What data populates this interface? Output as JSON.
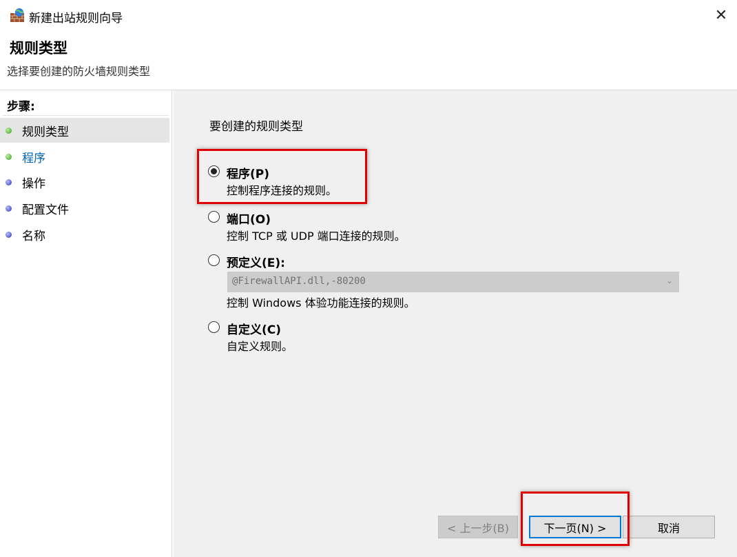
{
  "window": {
    "title": "新建出站规则向导",
    "close_glyph": "✕",
    "icon": "firewall-icon"
  },
  "header": {
    "title": "规则类型",
    "subtitle": "选择要创建的防火墙规则类型"
  },
  "steps": {
    "label": "步骤:",
    "items": [
      {
        "label": "规则类型",
        "status": "current",
        "dot_color": "#2e9e1e"
      },
      {
        "label": "程序",
        "status": "next",
        "dot_color": "#2e9e1e"
      },
      {
        "label": "操作",
        "status": "pending",
        "dot_color": "#2633b8"
      },
      {
        "label": "配置文件",
        "status": "pending",
        "dot_color": "#2633b8"
      },
      {
        "label": "名称",
        "status": "pending",
        "dot_color": "#2633b8"
      }
    ]
  },
  "content": {
    "section_label": "要创建的规则类型",
    "options": [
      {
        "label": "程序(P)",
        "desc": "控制程序连接的规则。",
        "checked": true
      },
      {
        "label": "端口(O)",
        "desc": "控制 TCP 或 UDP 端口连接的规则。",
        "checked": false
      },
      {
        "label": "预定义(E):",
        "desc": "控制 Windows 体验功能连接的规则。",
        "checked": false
      },
      {
        "label": "自定义(C)",
        "desc": "自定义规则。",
        "checked": false
      }
    ],
    "predefined_select": {
      "value": "@FirewallAPI.dll,-80200",
      "disabled": true
    }
  },
  "buttons": {
    "prev": "< 上一步(B)",
    "next": "下一页(N) >",
    "cancel": "取消"
  },
  "colors": {
    "highlight": "#e00000",
    "link": "#0063b1",
    "focus_border": "#0078d7"
  }
}
